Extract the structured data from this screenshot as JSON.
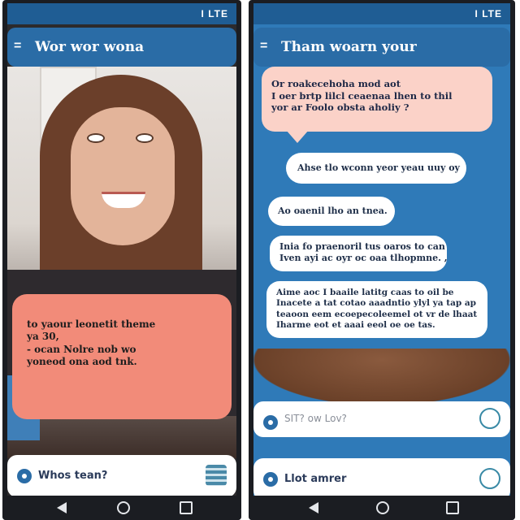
{
  "left_phone": {
    "status": "I LTE",
    "menu_icon": "menu-icon",
    "title": "Wor wor wona",
    "message_lines": [
      "to yaour leonetit theme",
      "ya 30,",
      "- ocan Nolre nob       wo",
      "  yoneod ona aod tnk."
    ],
    "input_text": "Whos tean?",
    "input_icon": "pin-icon",
    "action_icon": "robot-icon"
  },
  "right_phone": {
    "status": "I LTE",
    "menu_icon": "menu-icon",
    "title": "Tham woarn your",
    "bubbles": [
      {
        "lines": [
          "Or roakecehoha mod aot",
          "I oer brtp lilcl ceaenaa lhen to thil",
          "yor ar Foolo obsta aholiy ?"
        ]
      },
      {
        "lines": [
          "Ahse tlo wconn yeor yeau uuy oy"
        ]
      },
      {
        "lines": [
          "Ao oaenil lho an tnea."
        ]
      },
      {
        "lines": [
          "Inia fo praenoril tus oaros to can",
          "Iven ayi ac oyr oc oaa tlhopmne. ,"
        ]
      },
      {
        "lines": [
          "Aime aoc I baaile latitg caas to oil be",
          "Inacete a tat cotao aaadntio ylyl ya tap ap",
          "teaoon eem ecoepecoleemel ot vr de lhaat",
          "Iharme eot et aaai eeol oe oe tas."
        ]
      }
    ],
    "compose_placeholder": "SIT? ow Lov?",
    "compose_icon": "pin-icon",
    "input_text": "Llot amrer",
    "input_icon": "pin-icon",
    "action_icon": "chat-bubble-icon"
  },
  "colors": {
    "appbar": "#2a6ca6",
    "chat_bg": "#2f7ab8",
    "pink_bubble": "#f28b79",
    "light_pink_bubble": "#fbd2c8"
  }
}
